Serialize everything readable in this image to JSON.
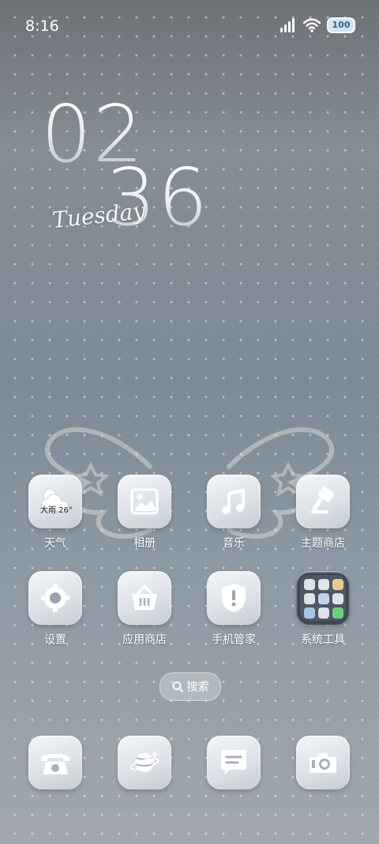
{
  "status_bar": {
    "time": "8:16",
    "battery": "100"
  },
  "clock": {
    "hour": "02",
    "minute": "36",
    "day": "Tuesday"
  },
  "apps": [
    {
      "label": "天气",
      "icon": "weather-icon",
      "widget_text": "大雨 26°"
    },
    {
      "label": "相册",
      "icon": "gallery-icon"
    },
    {
      "label": "音乐",
      "icon": "music-icon"
    },
    {
      "label": "主题商店",
      "icon": "theme-store-icon"
    },
    {
      "label": "设置",
      "icon": "settings-gear-icon"
    },
    {
      "label": "应用商店",
      "icon": "app-store-basket-icon"
    },
    {
      "label": "手机管家",
      "icon": "phone-manager-shield-icon"
    },
    {
      "label": "系统工具",
      "icon": "system-tools-folder-icon"
    }
  ],
  "search": {
    "label": "搜索"
  },
  "dock": [
    {
      "icon": "phone-icon"
    },
    {
      "icon": "browser-icon"
    },
    {
      "icon": "messages-icon"
    },
    {
      "icon": "camera-icon"
    }
  ],
  "colors": {
    "icon_glyph": "#ffffff",
    "icon_bg": "#dde2e8",
    "folder_bg": "#4d5864"
  }
}
